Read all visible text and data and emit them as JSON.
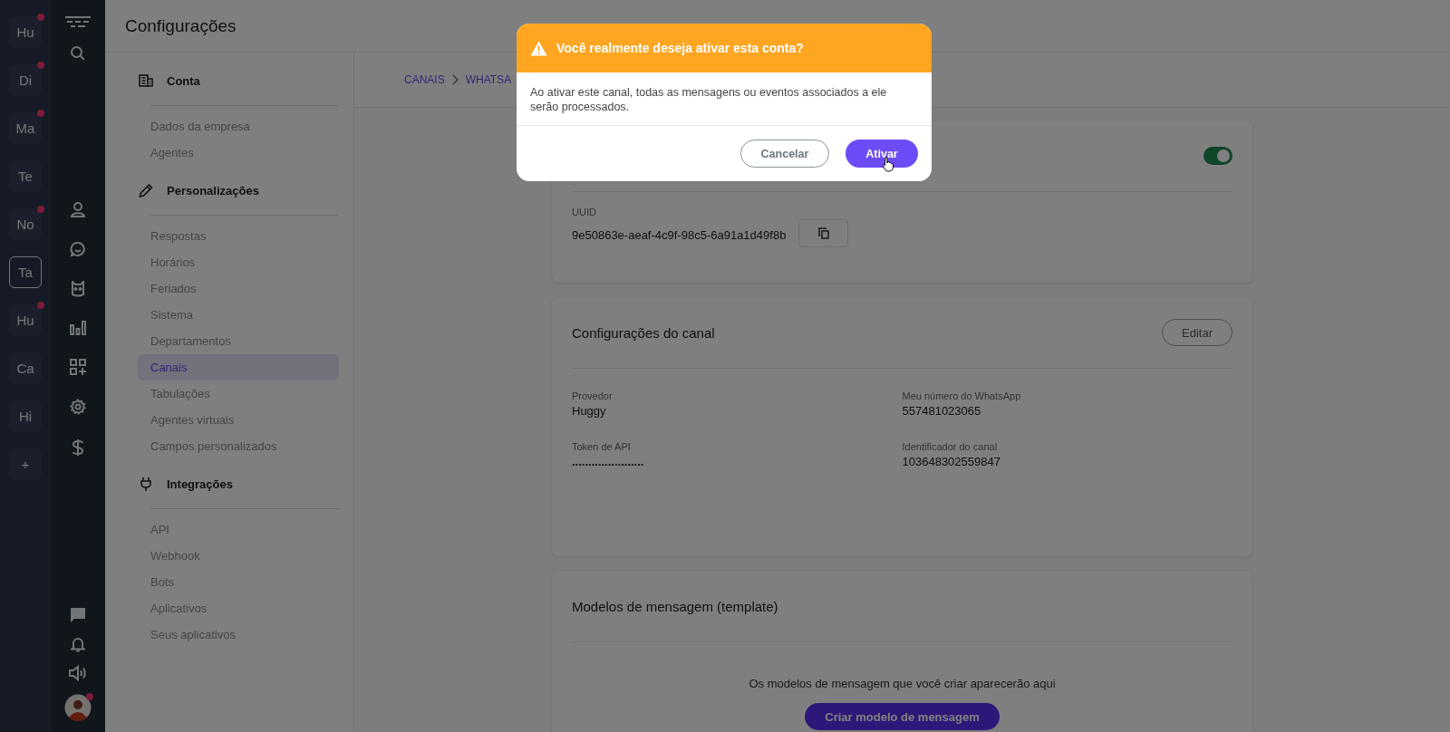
{
  "workspaces": [
    {
      "label": "Hu",
      "notification": true,
      "selected": false
    },
    {
      "label": "Di",
      "notification": true,
      "selected": false
    },
    {
      "label": "Ma",
      "notification": true,
      "selected": false
    },
    {
      "label": "Te",
      "notification": false,
      "selected": false
    },
    {
      "label": "No",
      "notification": true,
      "selected": false
    },
    {
      "label": "Ta",
      "notification": false,
      "selected": true
    },
    {
      "label": "Hu",
      "notification": true,
      "selected": false
    },
    {
      "label": "Ca",
      "notification": false,
      "selected": false
    },
    {
      "label": "Hi",
      "notification": false,
      "selected": false
    }
  ],
  "add_workspace": "+",
  "page_title": "Configurações",
  "settings_menu": [
    {
      "title": "Conta",
      "kind": "account",
      "items": [
        {
          "label": "Dados da empresa",
          "selected": false
        },
        {
          "label": "Agentes",
          "selected": false
        }
      ]
    },
    {
      "title": "Personalizações",
      "kind": "custom",
      "items": [
        {
          "label": "Respostas",
          "selected": false
        },
        {
          "label": "Horários",
          "selected": false
        },
        {
          "label": "Feriados",
          "selected": false
        },
        {
          "label": "Sistema",
          "selected": false
        },
        {
          "label": "Departamentos",
          "selected": false
        },
        {
          "label": "Canais",
          "selected": true
        },
        {
          "label": "Tabulações",
          "selected": false
        },
        {
          "label": "Agentes virtuais",
          "selected": false
        },
        {
          "label": "Campos personalizados",
          "selected": false
        }
      ]
    },
    {
      "title": "Integrações",
      "kind": "integration",
      "items": [
        {
          "label": "API",
          "selected": false
        },
        {
          "label": "Webhook",
          "selected": false
        },
        {
          "label": "Bots",
          "selected": false
        },
        {
          "label": "Aplicativos",
          "selected": false
        },
        {
          "label": "Seus aplicativos",
          "selected": false
        }
      ]
    }
  ],
  "breadcrumb": [
    "CANAIS",
    "WHATSA"
  ],
  "status_card": {
    "active": true,
    "uuid_label": "UUID",
    "uuid": "9e50863e-aeaf-4c9f-98c5-6a91a1d49f8b"
  },
  "channel_settings": {
    "title": "Configurações do canal",
    "edit_button": "Editar",
    "fields": [
      {
        "label": "Provedor",
        "value": "Huggy",
        "kind": "text"
      },
      {
        "label": "Meu número do WhatsApp",
        "value": "557481023065",
        "kind": "text"
      },
      {
        "label": "Token de API",
        "value": "......................",
        "kind": "secret"
      },
      {
        "label": "Identificador do canal",
        "value": "103648302559847",
        "kind": "text"
      }
    ]
  },
  "templates": {
    "title": "Modelos de mensagem (template)",
    "empty_text": "Os modelos de mensagem que você criar aparecerão aqui",
    "create_button": "Criar modelo de mensagem"
  },
  "dialog": {
    "title": "Você realmente deseja ativar esta conta?",
    "message": "Ao ativar este canal, todas as mensagens ou eventos associados a ele serão processados.",
    "buttons": [
      {
        "label": "Cancelar",
        "kind": "secondary",
        "hovered": false
      },
      {
        "label": "Ativar",
        "kind": "primary",
        "hovered": true
      }
    ]
  }
}
